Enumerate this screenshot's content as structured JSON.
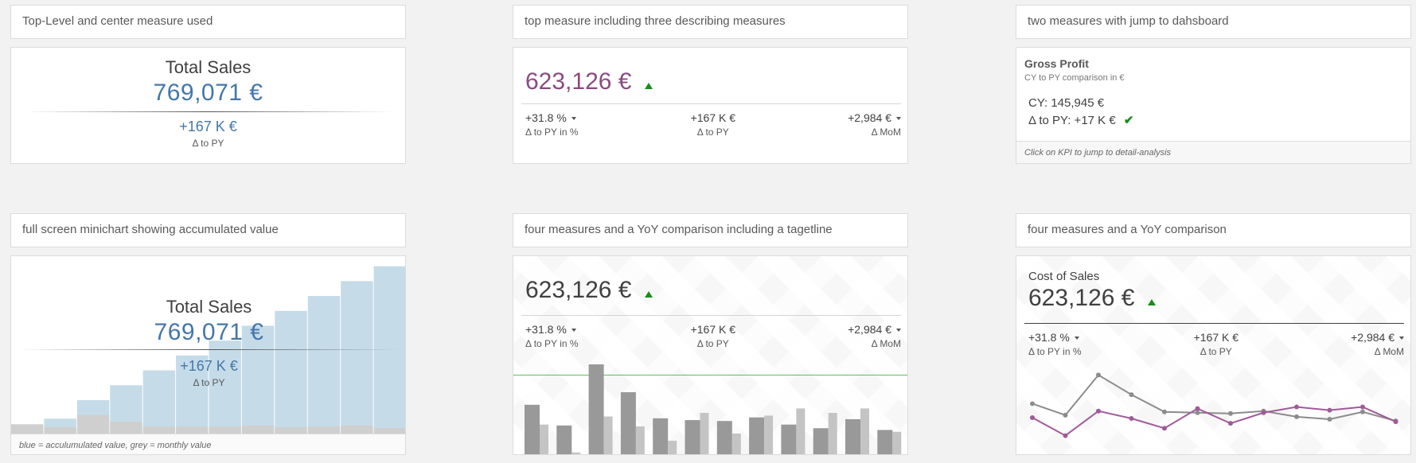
{
  "headers": {
    "h1": "Top-Level and center measure used",
    "h2": "top measure including three describing measures",
    "h3": "two measures with jump to dahsboard",
    "h4": "full screen minichart showing accumulated value",
    "h5": "four measures and a YoY comparison including a tagetline",
    "h6": "four measures and a YoY comparison"
  },
  "kpi1": {
    "title": "Total Sales",
    "value": "769,071 €",
    "delta": "+167 K €",
    "delta_label": "Δ to PY"
  },
  "kpi2": {
    "value": "623,126 €",
    "value_color": "#8a4b80",
    "cols": [
      {
        "value": "+31.8 %",
        "label": "Δ to PY in %"
      },
      {
        "value": "+167 K €",
        "label": "Δ to PY"
      },
      {
        "value": "+2,984 €",
        "label": "Δ MoM"
      }
    ]
  },
  "kpi3": {
    "title": "Gross Profit",
    "subtitle": "CY to PY comparison in €",
    "cy": "CY: 145,945 €",
    "delta": "Δ to PY: +17 K €",
    "footer": "Click on KPI to jump to detail-analysis"
  },
  "kpi4": {
    "title": "Total Sales",
    "value": "769,071 €",
    "delta": "+167 K €",
    "delta_label": "Δ to PY",
    "footer": "blue = acculumulated value, grey = monthly value"
  },
  "kpi5": {
    "value": "623,126 €",
    "cols": [
      {
        "value": "+31.8 %",
        "label": "Δ to PY in %"
      },
      {
        "value": "+167 K €",
        "label": "Δ to PY"
      },
      {
        "value": "+2,984 €",
        "label": "Δ MoM"
      }
    ]
  },
  "kpi6": {
    "title": "Cost of Sales",
    "value": "623,126 €",
    "cols": [
      {
        "value": "+31.8 %",
        "label": "Δ to PY in %"
      },
      {
        "value": "+167 K €",
        "label": "Δ to PY"
      },
      {
        "value": "+2,984 €",
        "label": "Δ MoM"
      }
    ]
  },
  "colors": {
    "accent_blue": "#4477aa",
    "purple": "#8a4b80",
    "green": "#1a8c1a",
    "bar_blue": "#c5dbe8",
    "bar_grey": "#cfcfcf"
  },
  "chart_data": [
    {
      "type": "bar",
      "series": [
        {
          "name": "acculumulated value",
          "values": [
            0,
            4,
            9,
            13,
            17,
            21,
            25,
            29,
            33,
            37,
            41,
            45
          ]
        },
        {
          "name": "monthly value",
          "values": [
            2.5,
            1.7,
            5,
            3.2,
            1.9,
            1.9,
            1.9,
            2.2,
            1.7,
            1.9,
            2.2,
            1.5
          ]
        }
      ],
      "ylim": [
        0,
        46
      ]
    },
    {
      "type": "bar",
      "series": [
        {
          "values": [
            55,
            32,
            100,
            69,
            40,
            38,
            37,
            41,
            33,
            29,
            39,
            27
          ]
        },
        {
          "values": [
            33,
            2,
            42,
            31,
            15,
            46,
            23,
            43,
            51,
            46,
            51,
            25
          ]
        }
      ],
      "target": 88,
      "ylim": [
        0,
        100
      ]
    },
    {
      "type": "line",
      "series": [
        {
          "values": [
            52,
            38,
            87,
            63,
            42,
            41,
            40,
            43,
            36,
            33,
            42,
            31
          ]
        },
        {
          "values": [
            35,
            13,
            43,
            34,
            22,
            46,
            28,
            41,
            48,
            44,
            48,
            30
          ]
        }
      ],
      "ylim": [
        0,
        100
      ]
    }
  ]
}
